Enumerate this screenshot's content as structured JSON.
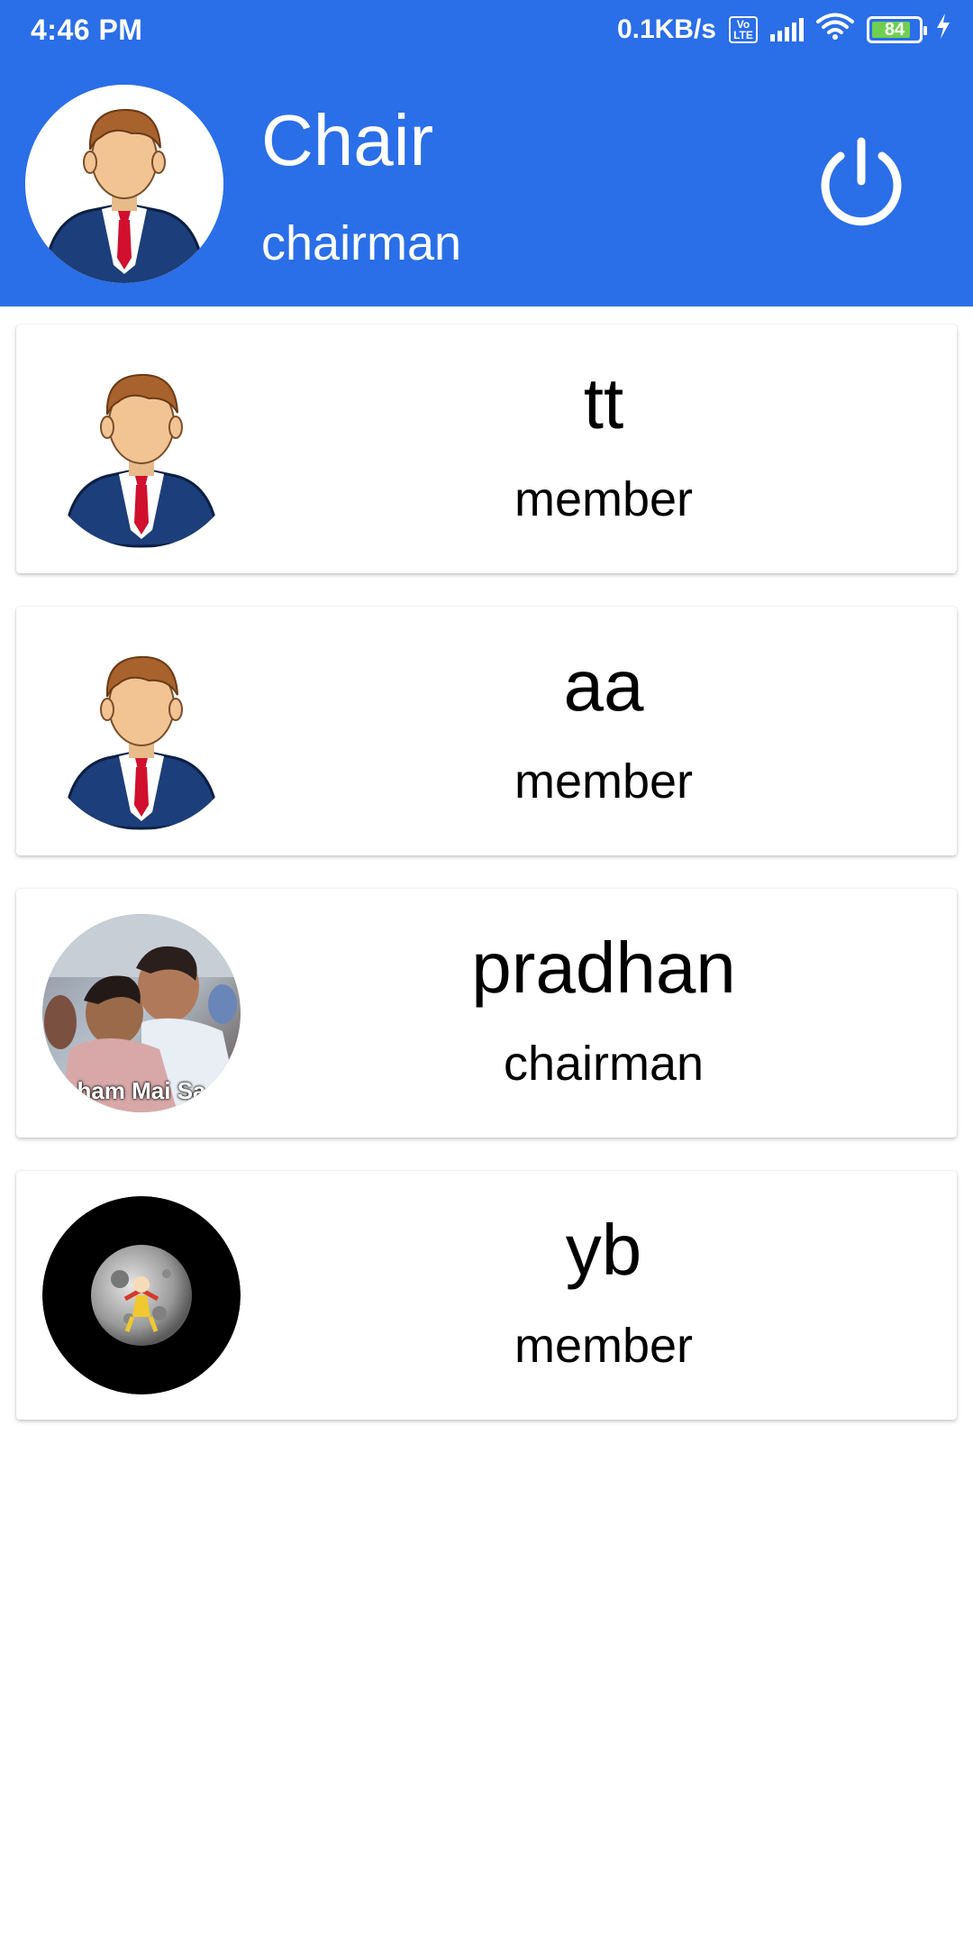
{
  "status_bar": {
    "time": "4:46 PM",
    "network_speed": "0.1KB/s",
    "volte_top": "Vo",
    "volte_bottom": "LTE",
    "battery_level": "84"
  },
  "header": {
    "name": "Chair",
    "role": "chairman",
    "avatar_icon": "businessman-avatar-icon",
    "power_icon": "power-icon"
  },
  "members": [
    {
      "name": "tt",
      "role": "member",
      "avatar": "businessman-avatar-icon"
    },
    {
      "name": "aa",
      "role": "member",
      "avatar": "businessman-avatar-icon"
    },
    {
      "name": "pradhan",
      "role": "chairman",
      "avatar": "photo-avatar",
      "avatar_caption": "ham Mai Sa"
    },
    {
      "name": "yb",
      "role": "member",
      "avatar": "moon-avatar"
    }
  ],
  "colors": {
    "primary": "#2a6ee8",
    "card_background": "#ffffff",
    "text": "#000000"
  }
}
